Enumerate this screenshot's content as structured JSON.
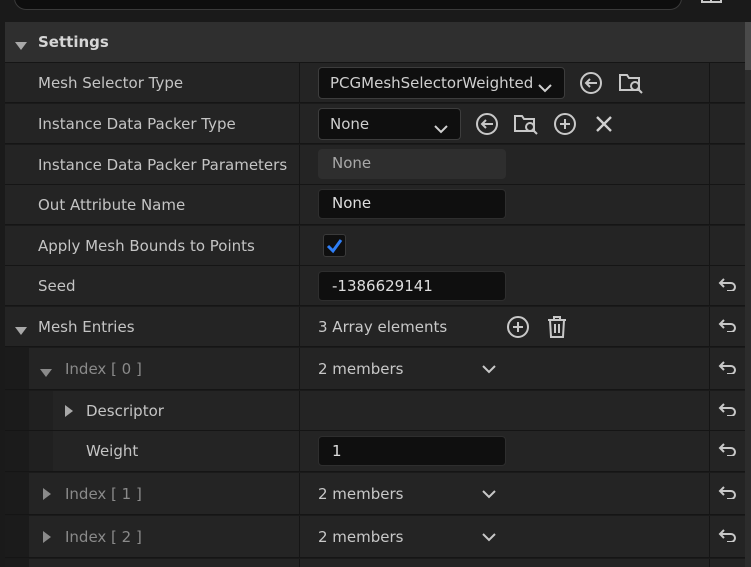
{
  "section": {
    "title": "Settings"
  },
  "rows": {
    "mesh_selector_type": {
      "label": "Mesh Selector Type",
      "value": "PCGMeshSelectorWeighted"
    },
    "instance_packer_type": {
      "label": "Instance Data Packer Type",
      "value": "None"
    },
    "instance_packer_params": {
      "label": "Instance Data Packer Parameters",
      "value": "None"
    },
    "out_attribute_name": {
      "label": "Out Attribute Name",
      "value": "None"
    },
    "apply_mesh_bounds": {
      "label": "Apply Mesh Bounds to Points",
      "checked": true
    },
    "seed": {
      "label": "Seed",
      "value": "-1386629141"
    },
    "mesh_entries": {
      "label": "Mesh Entries",
      "summary": "3 Array elements"
    },
    "index_0": {
      "label": "Index [ 0 ]",
      "summary": "2 members"
    },
    "descriptor": {
      "label": "Descriptor"
    },
    "weight": {
      "label": "Weight",
      "value": "1"
    },
    "index_1": {
      "label": "Index [ 1 ]",
      "summary": "2 members"
    },
    "index_2": {
      "label": "Index [ 2 ]",
      "summary": "2 members"
    }
  },
  "colors": {
    "accent": "#2f7ff7",
    "panel": "#242424",
    "header": "#2f2f2f",
    "field": "#0f0f0f"
  }
}
